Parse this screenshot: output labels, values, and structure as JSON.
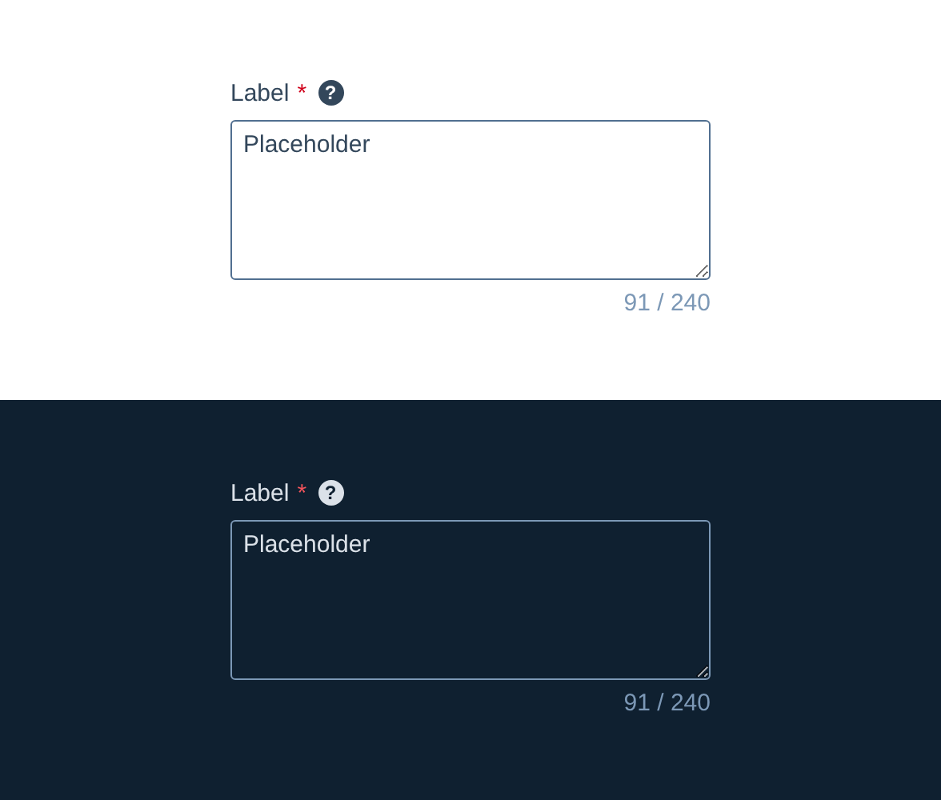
{
  "panels": [
    {
      "kind": "light",
      "label": "Label",
      "required_mark": "*",
      "help": "?",
      "placeholder": "Placeholder",
      "counter": "91 / 240"
    },
    {
      "kind": "dark",
      "label": "Label",
      "required_mark": "*",
      "help": "?",
      "placeholder": "Placeholder",
      "counter": "91 / 240"
    }
  ]
}
